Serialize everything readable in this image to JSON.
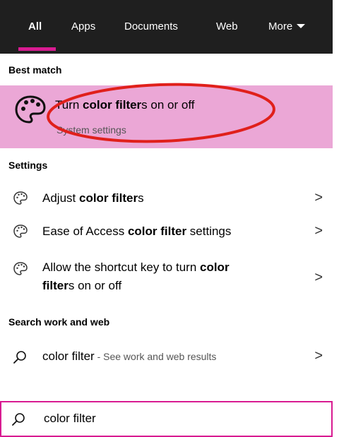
{
  "tabs": [
    {
      "label": "All",
      "active": true
    },
    {
      "label": "Apps"
    },
    {
      "label": "Documents"
    },
    {
      "label": "Web"
    },
    {
      "label": "More"
    }
  ],
  "best_match": {
    "heading": "Best match",
    "title_pre": "Turn ",
    "title_bold": "color filter",
    "title_post": "s on or off",
    "subtitle": "System settings",
    "icon": "palette-icon",
    "highlight_color": "#eba7d6",
    "annotation_color": "#e0201b"
  },
  "settings": {
    "heading": "Settings",
    "items": [
      {
        "pre": "Adjust ",
        "bold": "color filter",
        "post": "s"
      },
      {
        "pre": "Ease of Access ",
        "bold": "color filter",
        "post": " settings"
      },
      {
        "pre": "Allow the shortcut key to turn ",
        "bold": "color",
        "line2_bold": "filter",
        "line2_post": "s on or off"
      }
    ],
    "icon": "palette-outline-icon"
  },
  "web": {
    "heading": "Search work and web",
    "query": "color filter",
    "hint": " - See work and web results",
    "icon": "search-icon"
  },
  "search_box": {
    "value": "color filter",
    "icon": "search-icon"
  },
  "accent": "#d81b91",
  "chevron": ">"
}
